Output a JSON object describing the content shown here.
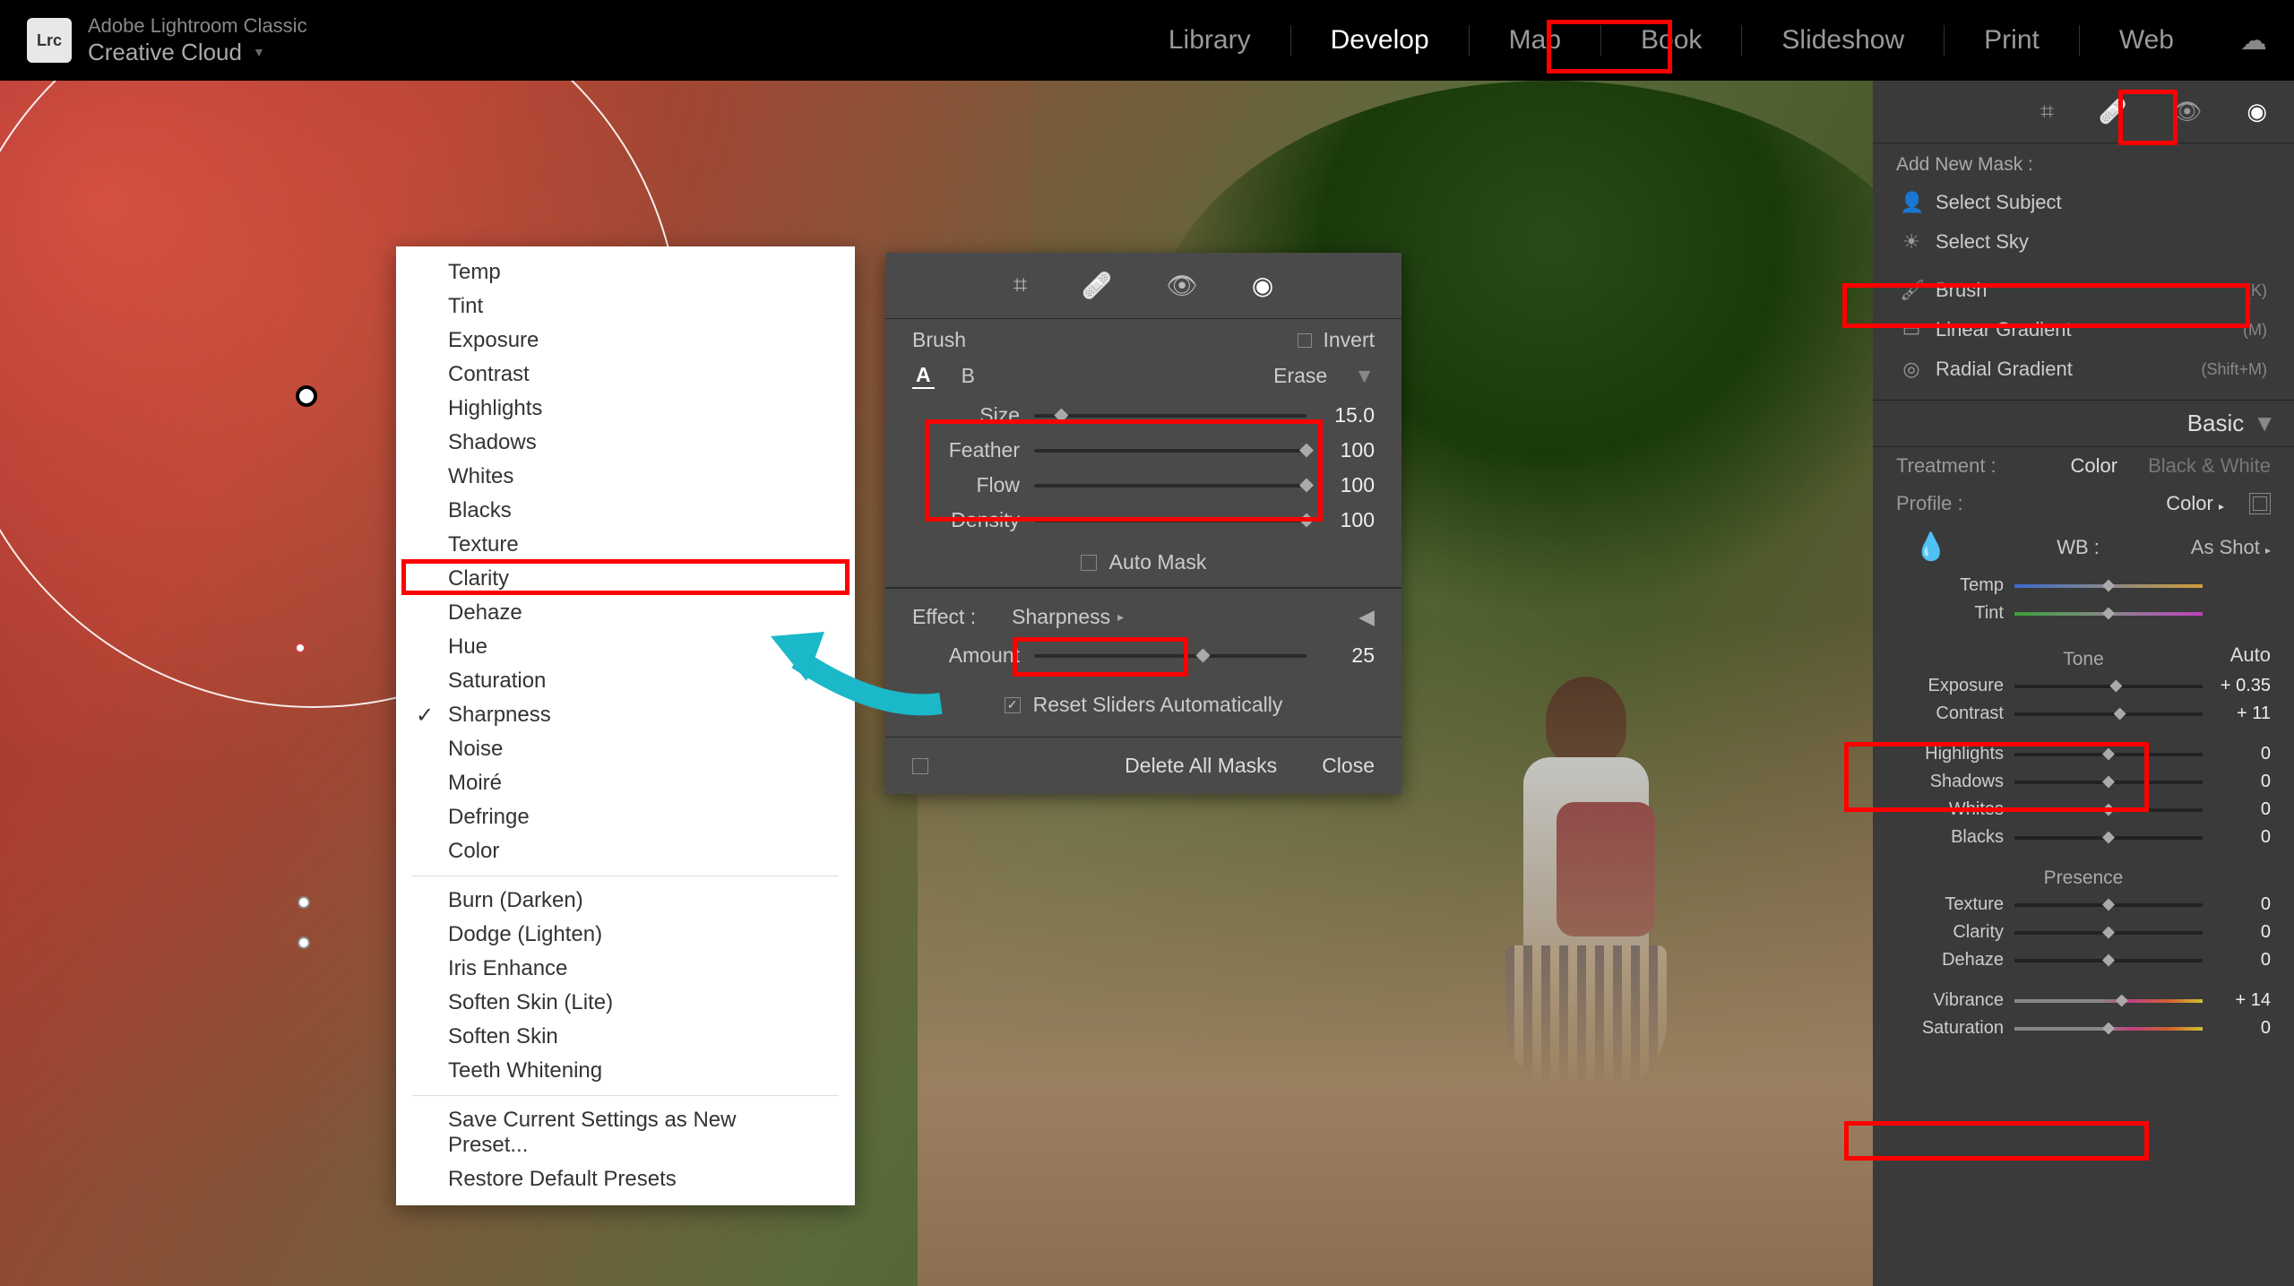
{
  "app": {
    "name": "Adobe Lightroom Classic",
    "subtitle": "Creative Cloud",
    "logo": "Lrc"
  },
  "modules": {
    "items": [
      "Library",
      "Develop",
      "Map",
      "Book",
      "Slideshow",
      "Print",
      "Web"
    ],
    "active": "Develop"
  },
  "context_menu": {
    "group1": [
      "Temp",
      "Tint",
      "Exposure",
      "Contrast",
      "Highlights",
      "Shadows",
      "Whites",
      "Blacks",
      "Texture",
      "Clarity",
      "Dehaze",
      "Hue",
      "Saturation",
      "Sharpness",
      "Noise",
      "Moiré",
      "Defringe",
      "Color"
    ],
    "checked": "Sharpness",
    "highlighted": "Clarity",
    "group2": [
      "Burn (Darken)",
      "Dodge (Lighten)",
      "Iris Enhance",
      "Soften Skin (Lite)",
      "Soften Skin",
      "Teeth Whitening"
    ],
    "group3": [
      "Save Current Settings as New Preset...",
      "Restore Default Presets"
    ]
  },
  "brush_panel": {
    "title": "Brush",
    "invert": "Invert",
    "tabs": {
      "a": "A",
      "b": "B",
      "erase": "Erase"
    },
    "sliders": {
      "size": {
        "label": "Size",
        "value": "15.0",
        "pos": 10
      },
      "feather": {
        "label": "Feather",
        "value": "100",
        "pos": 100
      },
      "flow": {
        "label": "Flow",
        "value": "100",
        "pos": 100
      },
      "density": {
        "label": "Density",
        "value": "100",
        "pos": 100
      }
    },
    "automask": {
      "label": "Auto Mask",
      "checked": false
    },
    "effect_label": "Effect :",
    "effect_value": "Sharpness",
    "amount": {
      "label": "Amount",
      "value": "25",
      "pos": 62
    },
    "reset": {
      "label": "Reset Sliders Automatically",
      "checked": true
    },
    "footer": {
      "delete": "Delete All Masks",
      "close": "Close"
    }
  },
  "rightpanel": {
    "masks": {
      "header": "Add New Mask :",
      "subject": "Select Subject",
      "sky": "Select Sky",
      "brush": {
        "label": "Brush",
        "shortcut": "(K)"
      },
      "linear": {
        "label": "Linear Gradient",
        "shortcut": "(M)"
      },
      "radial": {
        "label": "Radial Gradient",
        "shortcut": "(Shift+M)"
      }
    },
    "basic_label": "Basic",
    "treatment": {
      "label": "Treatment :",
      "color": "Color",
      "bw": "Black & White"
    },
    "profile": {
      "label": "Profile :",
      "value": "Color"
    },
    "wb": {
      "label": "WB :",
      "value": "As Shot"
    },
    "temp": {
      "label": "Temp",
      "value": "",
      "pos": 50
    },
    "tint": {
      "label": "Tint",
      "value": "",
      "pos": 50
    },
    "tone_header": "Tone",
    "auto": "Auto",
    "exposure": {
      "label": "Exposure",
      "value": "+ 0.35",
      "pos": 54
    },
    "contrast": {
      "label": "Contrast",
      "value": "+ 11",
      "pos": 56
    },
    "highlights": {
      "label": "Highlights",
      "value": "0",
      "pos": 50
    },
    "shadows": {
      "label": "Shadows",
      "value": "0",
      "pos": 50
    },
    "whites": {
      "label": "Whites",
      "value": "0",
      "pos": 50
    },
    "blacks": {
      "label": "Blacks",
      "value": "0",
      "pos": 50
    },
    "presence_header": "Presence",
    "texture": {
      "label": "Texture",
      "value": "0",
      "pos": 50
    },
    "clarity": {
      "label": "Clarity",
      "value": "0",
      "pos": 50
    },
    "dehaze": {
      "label": "Dehaze",
      "value": "0",
      "pos": 50
    },
    "vibrance": {
      "label": "Vibrance",
      "value": "+ 14",
      "pos": 57
    },
    "saturation": {
      "label": "Saturation",
      "value": "0",
      "pos": 50
    }
  }
}
